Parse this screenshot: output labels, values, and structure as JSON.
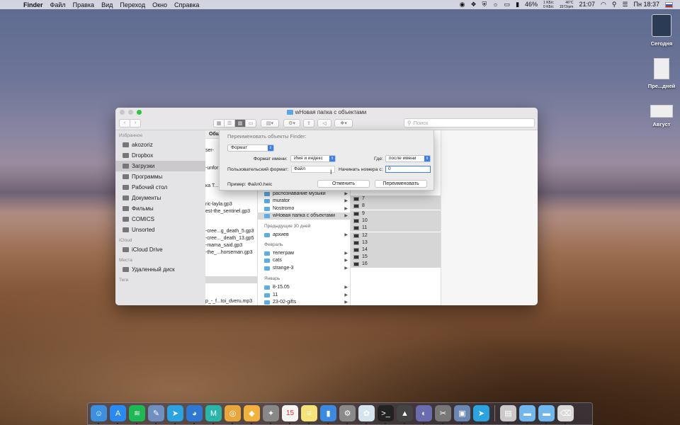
{
  "menubar": {
    "apple": "",
    "app": "Finder",
    "items": [
      "Файл",
      "Правка",
      "Вид",
      "Переход",
      "Окно",
      "Справка"
    ],
    "battery": "46%",
    "net_up": "1 KБ/с",
    "net_down": "0 KБ/с",
    "cpu_temp": "46°C",
    "fan": "1572rpm",
    "clock_digital": "21:07",
    "datetime": "Пн 18:37"
  },
  "desktop": {
    "icons": [
      {
        "label": "Сегодня"
      },
      {
        "label": "Пре...дней"
      },
      {
        "label": "Август"
      }
    ]
  },
  "window": {
    "title": "wНовая папка с объектами",
    "search_placeholder": "Поиск"
  },
  "sidebar": {
    "favorites_label": "Избранное",
    "items": [
      {
        "label": "akozoriz",
        "icon": "home-icon"
      },
      {
        "label": "Dropbox",
        "icon": "dropbox-icon"
      },
      {
        "label": "Загрузки",
        "icon": "downloads-icon",
        "selected": true
      },
      {
        "label": "Программы",
        "icon": "apps-icon"
      },
      {
        "label": "Рабочий стол",
        "icon": "desktop-icon"
      },
      {
        "label": "Документы",
        "icon": "documents-icon"
      },
      {
        "label": "Фильмы",
        "icon": "movies-icon"
      },
      {
        "label": "COMICS",
        "icon": "folder-icon"
      },
      {
        "label": "Unsorted",
        "icon": "folder-icon"
      }
    ],
    "icloud_label": "iCloud",
    "icloud_items": [
      {
        "label": "iCloud Drive"
      }
    ],
    "places_label": "Места",
    "places_items": [
      {
        "label": "Удаленный диск"
      }
    ],
    "tags_label": "Теги"
  },
  "column1": {
    "header": "Обш",
    "rows": [
      {
        "label": "ser-"
      },
      {
        "label": "-unfor"
      },
      {
        "label": "ка Т..."
      },
      {
        "label": "ric-layla.gp3"
      },
      {
        "label": "est-the_sentinel.gp3"
      },
      {
        "label": "-cree...g_death_5.gp3"
      },
      {
        "label": "-cree..._death_13.gp5"
      },
      {
        "label": "-mama_said.gp3"
      },
      {
        "label": "-the_...horseman.gp3"
      },
      {
        "label": ""
      },
      {
        "label": "p_-_f...toi_dveru.mp3"
      }
    ]
  },
  "column2": {
    "rows": [
      {
        "label": "распознавание музыки"
      },
      {
        "label": "murator"
      },
      {
        "label": "Nostromo"
      },
      {
        "label": "wНовая папка с объектами"
      }
    ],
    "section_prev30": "Предыдущие 30 дней",
    "prev30_rows": [
      {
        "label": "архиев"
      }
    ],
    "section_feb": "Февраль",
    "feb_rows": [
      {
        "label": "телеграм"
      },
      {
        "label": "cats"
      },
      {
        "label": "strange-3"
      }
    ],
    "section_jan": "Январь",
    "jan_rows": [
      {
        "label": "8-15.05"
      },
      {
        "label": "11"
      },
      {
        "label": "23-02-gifts"
      }
    ]
  },
  "column3": {
    "rows": [
      "7",
      "8",
      "9",
      "10",
      "11",
      "12",
      "13",
      "14",
      "15",
      "16"
    ]
  },
  "rename_sheet": {
    "title": "Переименовать объекты Finder:",
    "mode": "Формат",
    "name_format_label": "Формат имени:",
    "name_format_value": "Имя и индекс",
    "where_label": "Где:",
    "where_value": "после имени",
    "custom_format_label": "Пользовательский формат:",
    "custom_format_value": "Файл",
    "start_label": "Начинать номера с:",
    "start_value": "0",
    "example": "Пример: Файл0.heic",
    "cancel": "Отменить",
    "rename": "Переименовать"
  },
  "dock": {
    "apps": [
      {
        "icon": "finder-icon",
        "color": "#3d8fe0"
      },
      {
        "icon": "app-store-icon",
        "color": "#2a8af3"
      },
      {
        "icon": "spotify-icon",
        "color": "#1db954"
      },
      {
        "icon": "xcode-preview-icon",
        "color": "#6e8fbf"
      },
      {
        "icon": "telegram-icon",
        "color": "#2aa3e0"
      },
      {
        "icon": "twitterrific-icon",
        "color": "#2c78d4"
      },
      {
        "icon": "mplus-icon",
        "color": "#29b5a8"
      },
      {
        "icon": "chrome-icon",
        "color": "#e9a63a"
      },
      {
        "icon": "sketch-icon",
        "color": "#f2b13a"
      },
      {
        "icon": "launchpad-icon",
        "color": "#888888"
      },
      {
        "icon": "calendar-icon",
        "color": "#f4f4f4"
      },
      {
        "icon": "notes-icon",
        "color": "#f7e27a"
      },
      {
        "icon": "bookmarks-icon",
        "color": "#3a8be0"
      },
      {
        "icon": "system-preferences-icon",
        "color": "#8a8a8a"
      },
      {
        "icon": "paw-icon",
        "color": "#d6e4f0"
      },
      {
        "icon": "terminal-icon",
        "color": "#222222"
      },
      {
        "icon": "installer-icon",
        "color": "#444444"
      },
      {
        "icon": "firefox-icon",
        "color": "#6b6bb0"
      },
      {
        "icon": "scripts-icon",
        "color": "#777777"
      },
      {
        "icon": "screenshot-icon",
        "color": "#6a88b3"
      },
      {
        "icon": "telegram2-icon",
        "color": "#2aa3e0"
      }
    ],
    "right": [
      {
        "icon": "downloads-stack-icon",
        "color": "#c9c9c9"
      },
      {
        "icon": "folder-stack-icon",
        "color": "#6fb7ec"
      },
      {
        "icon": "folder-stack-icon",
        "color": "#6fb7ec"
      },
      {
        "icon": "trash-icon",
        "color": "#d9d9d9"
      }
    ],
    "calendar_day": "15"
  },
  "colors": {
    "accent": "#3b7ef2",
    "folder": "#5aaee8"
  }
}
